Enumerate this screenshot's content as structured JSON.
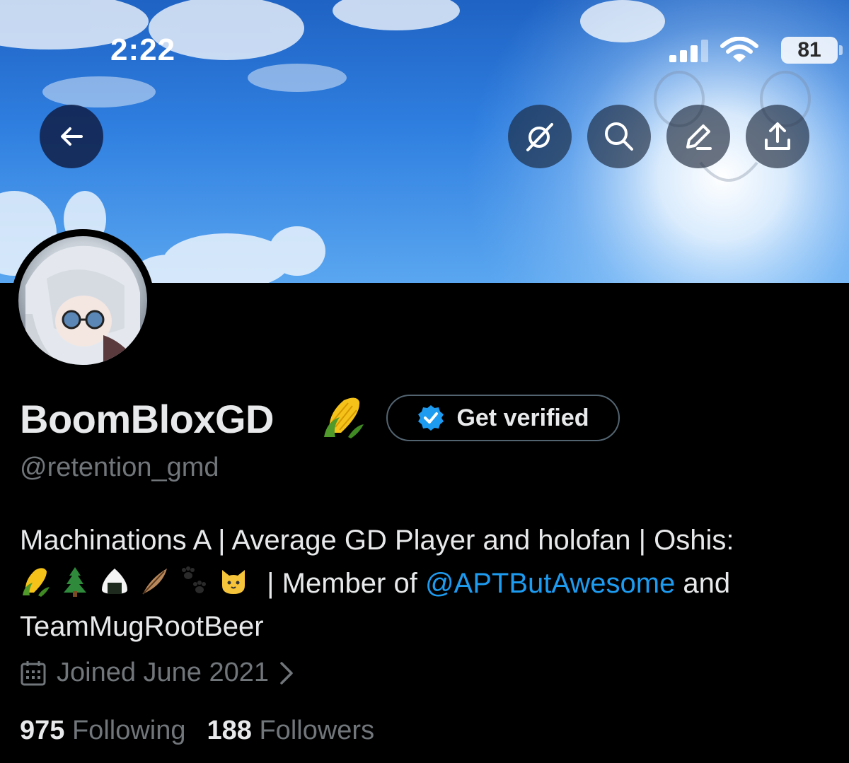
{
  "status_bar": {
    "time": "2:22",
    "battery": "81"
  },
  "header": {
    "buttons": [
      {
        "name": "back",
        "icon": "arrow-left-icon"
      },
      {
        "name": "grok",
        "icon": "grok-icon"
      },
      {
        "name": "search",
        "icon": "search-icon"
      },
      {
        "name": "edit",
        "icon": "pencil-icon"
      },
      {
        "name": "share",
        "icon": "share-icon"
      }
    ]
  },
  "profile": {
    "display_name": "BoomBloxGD",
    "name_emoji": "corn",
    "verify_label": "Get verified",
    "handle": "@retention_gmd",
    "bio": {
      "line1": "Machinations A | Average GD Player and holofan | Oshis:",
      "emojis": [
        "corn",
        "evergreen-tree",
        "rice-ball",
        "feather",
        "paw-prints",
        "cat-face"
      ],
      "member_text": "| Member of",
      "mention": "@APTButAwesome",
      "and_text": "and",
      "line3": "TeamMugRootBeer"
    },
    "joined": "Joined June 2021",
    "following_count": "975",
    "following_label": "Following",
    "followers_count": "188",
    "followers_label": "Followers"
  },
  "colors": {
    "background": "#000000",
    "text": "#e7e9ea",
    "muted": "#71767b",
    "accent": "#1d9bf0",
    "verified_badge": "#1d9bf0"
  }
}
